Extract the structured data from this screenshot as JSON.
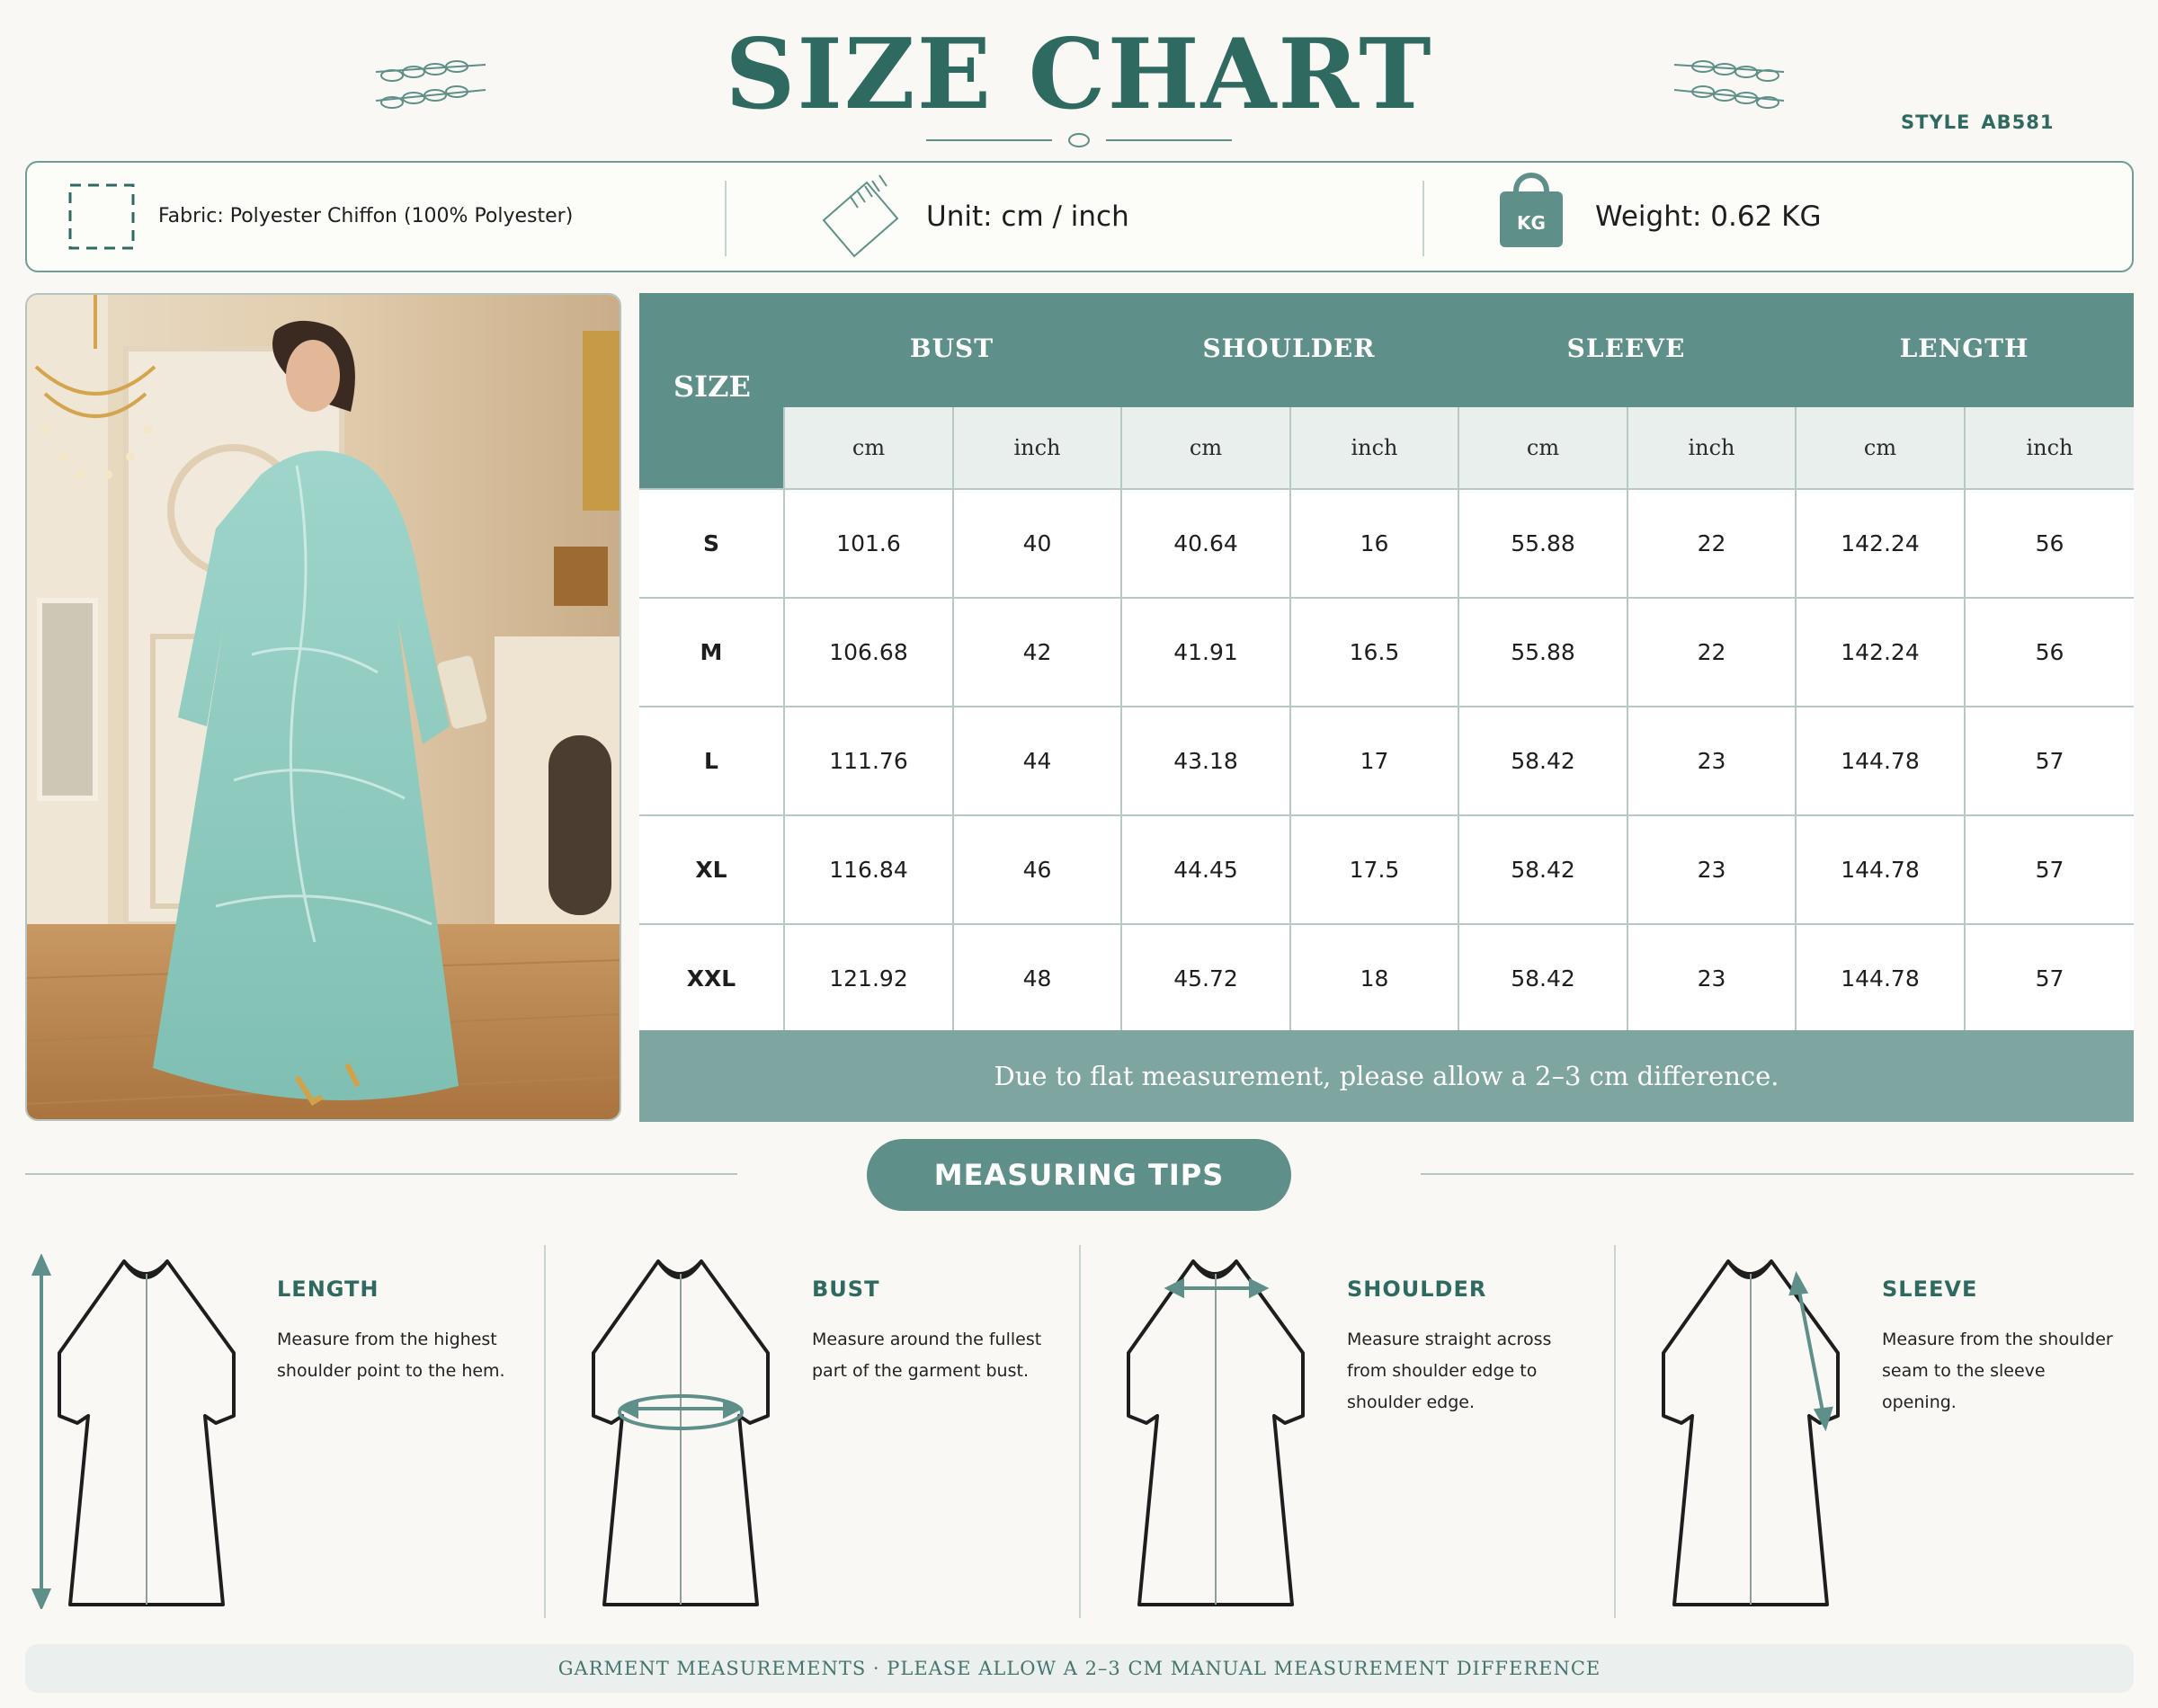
{
  "header": {
    "title": "SIZE CHART",
    "style_label": "STYLE",
    "style_code": "AB581"
  },
  "info": {
    "fabric": "Fabric: Polyester Chiffon (100% Polyester)",
    "unit": "Unit: cm / inch",
    "weight_badge": "KG",
    "weight": "Weight: 0.62 KG"
  },
  "photo": {
    "subject": "model-in-mint-embroidered-abaya"
  },
  "size_table": {
    "size_header": "SIZE",
    "groups": [
      "BUST",
      "SHOULDER",
      "SLEEVE",
      "LENGTH"
    ],
    "units": [
      "cm",
      "inch",
      "cm",
      "inch",
      "cm",
      "inch",
      "cm",
      "inch"
    ],
    "rows": [
      {
        "size": "S",
        "values": [
          "101.6",
          "40",
          "40.64",
          "16",
          "55.88",
          "22",
          "142.24",
          "56"
        ]
      },
      {
        "size": "M",
        "values": [
          "106.68",
          "42",
          "41.91",
          "16.5",
          "55.88",
          "22",
          "142.24",
          "56"
        ]
      },
      {
        "size": "L",
        "values": [
          "111.76",
          "44",
          "43.18",
          "17",
          "58.42",
          "23",
          "144.78",
          "57"
        ]
      },
      {
        "size": "XL",
        "values": [
          "116.84",
          "46",
          "44.45",
          "17.5",
          "58.42",
          "23",
          "144.78",
          "57"
        ]
      },
      {
        "size": "XXL",
        "values": [
          "121.92",
          "48",
          "45.72",
          "18",
          "58.42",
          "23",
          "144.78",
          "57"
        ]
      }
    ],
    "note": "Due to flat measurement, please allow a 2–3 cm difference."
  },
  "measuring_tips": {
    "title": "MEASURING TIPS",
    "tips": [
      {
        "heading": "LENGTH",
        "lines": [
          "Measure from the highest",
          "shoulder point to the hem."
        ]
      },
      {
        "heading": "BUST",
        "lines": [
          "Measure around the fullest",
          "part of the garment bust."
        ]
      },
      {
        "heading": "SHOULDER",
        "lines": [
          "Measure straight across",
          "from shoulder edge to",
          "shoulder edge."
        ]
      },
      {
        "heading": "SLEEVE",
        "lines": [
          "Measure from the shoulder",
          "seam to the sleeve",
          "opening."
        ]
      }
    ]
  },
  "footer": "GARMENT MEASUREMENTS · PLEASE ALLOW A 2–3 CM MANUAL MEASUREMENT DIFFERENCE",
  "colors": {
    "accent": "#5e8f88",
    "title": "#2f6a61",
    "note_band": "#7ea59f",
    "background": "#f9f8f4"
  },
  "icons": [
    "leaf-ornament-icon",
    "fabric-swatch-icon",
    "measuring-tape-icon",
    "weight-bag-icon",
    "arrow-icon"
  ]
}
